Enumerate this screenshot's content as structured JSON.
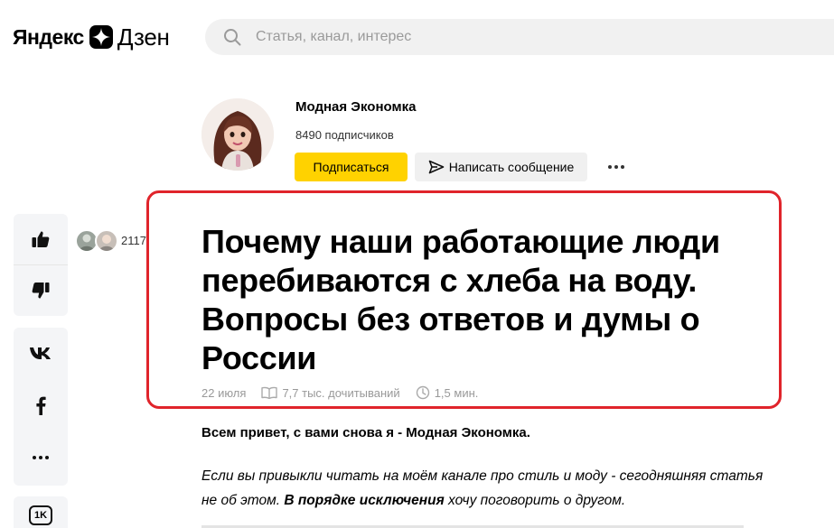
{
  "header": {
    "logo_part1": "Яндекс",
    "logo_part2": "Дзен",
    "search_placeholder": "Статья, канал, интерес"
  },
  "channel": {
    "name": "Модная Экономка",
    "subscribers": "8490 подписчиков",
    "subscribe_label": "Подписаться",
    "message_label": "Написать сообщение"
  },
  "rail": {
    "likes_count": "2117",
    "share_count_badge": "1K"
  },
  "article": {
    "title": "Почему наши работающие люди перебиваются с хлеба на воду. Вопросы без ответов и думы о России",
    "date": "22 июля",
    "reads": "7,7 тыс. дочитываний",
    "read_time": "1,5 мин.",
    "lead": "Всем привет, с вами снова я - Модная Экономка.",
    "para_part1": "Если вы привыкли читать на моём канале про стиль и моду - сегодняшняя статья не об этом. ",
    "para_bold": "В порядке исключения",
    "para_part2": " хочу поговорить о другом."
  },
  "colors": {
    "accent_yellow": "#ffd200",
    "highlight_red": "#e0242b",
    "rail_bg": "#f4f5f7",
    "search_bg": "#f1f1f1"
  }
}
